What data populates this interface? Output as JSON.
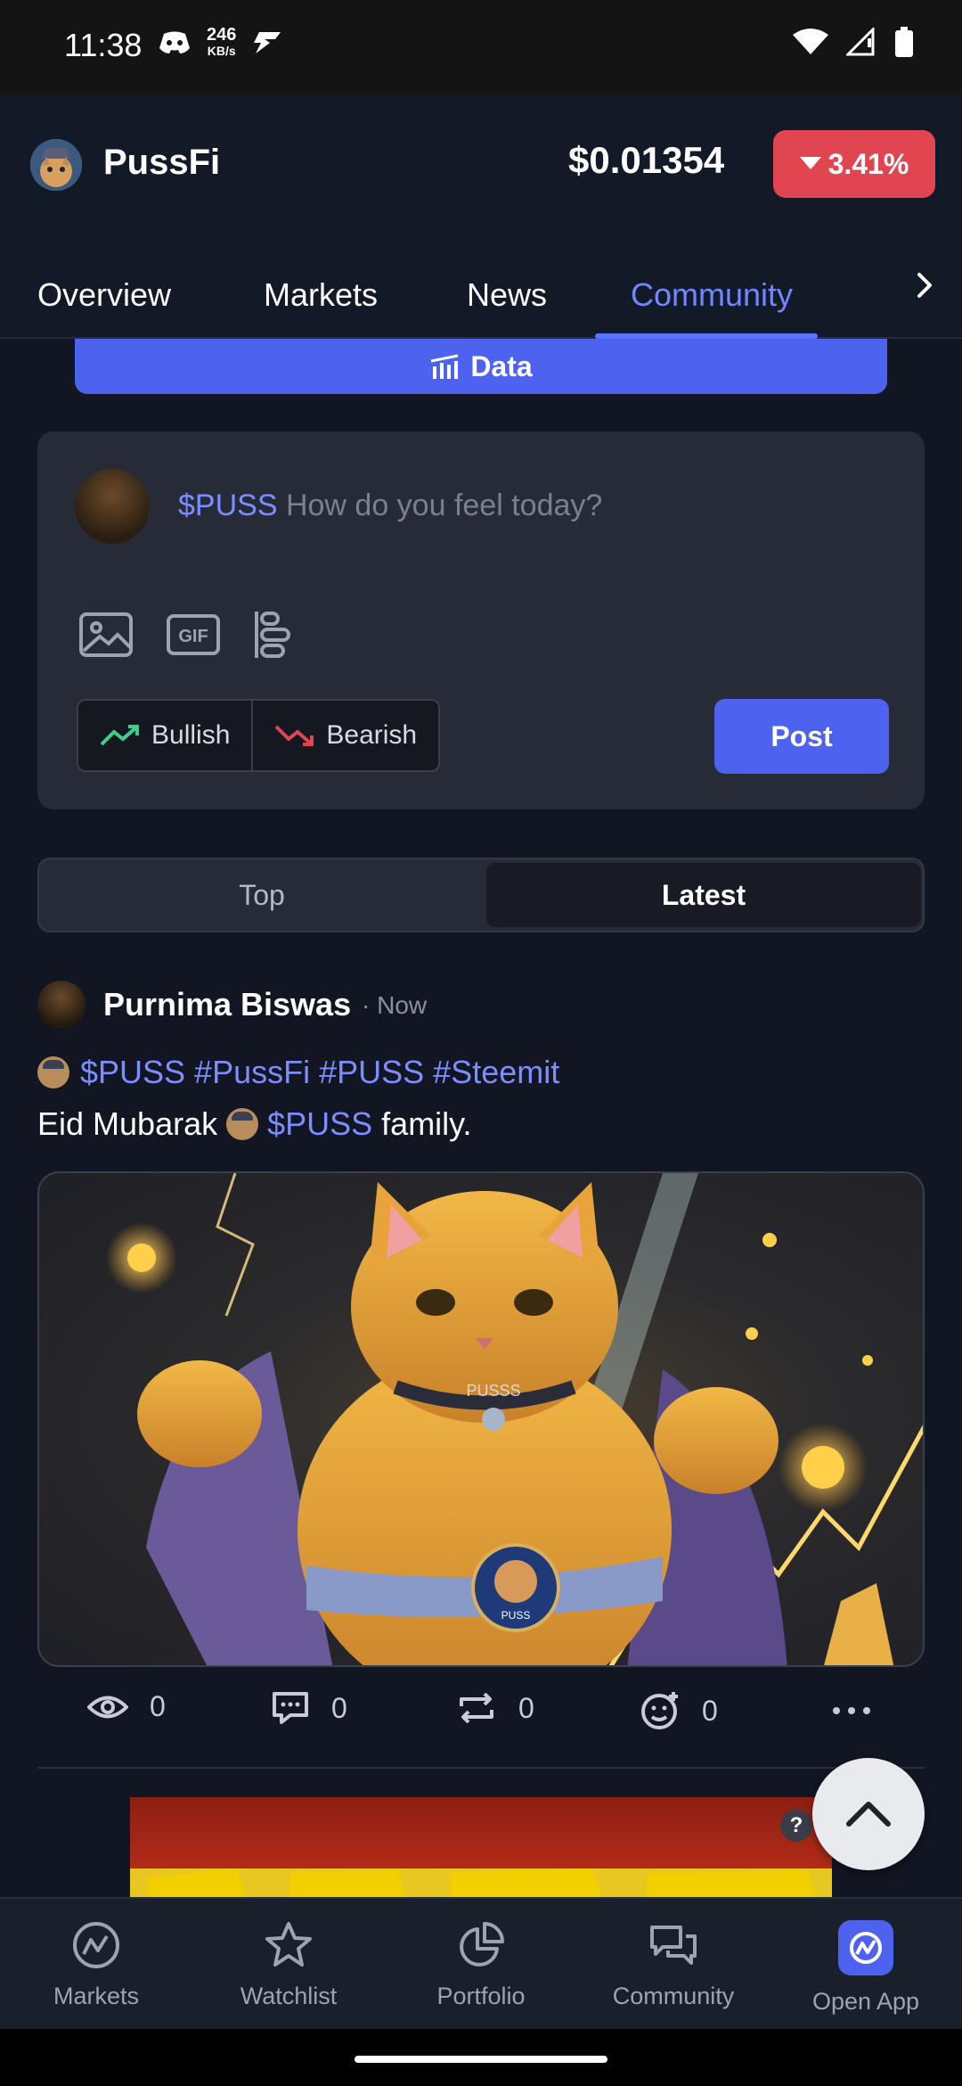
{
  "status_bar": {
    "time": "11:38",
    "net_speed": "246",
    "net_unit": "KB/s"
  },
  "header": {
    "app_name": "PussFi",
    "price": "$0.01354",
    "change": "3.41%"
  },
  "tabs": [
    {
      "label": "Overview"
    },
    {
      "label": "Markets"
    },
    {
      "label": "News"
    },
    {
      "label": "Community"
    }
  ],
  "data_button": {
    "label": "Data"
  },
  "composer": {
    "ticker_tag": "$PUSS",
    "placeholder": "How do you feel today?",
    "bullish_label": "Bullish",
    "bearish_label": "Bearish",
    "post_label": "Post",
    "gif_label": "GIF"
  },
  "sort": {
    "top_label": "Top",
    "latest_label": "Latest"
  },
  "post": {
    "author": "Purnima Biswas",
    "time": "· Now",
    "tags_line": "$PUSS #PussFi #PUSS #Steemit",
    "text_prefix": "Eid Mubarak",
    "text_tag": "$PUSS",
    "text_suffix": "family.",
    "image_collar_text": "PUSSS",
    "image_badge_text": "PUSS",
    "stats": {
      "views": "0",
      "comments": "0",
      "reposts": "0",
      "reactions": "0"
    }
  },
  "bottom_nav": [
    {
      "label": "Markets"
    },
    {
      "label": "Watchlist"
    },
    {
      "label": "Portfolio"
    },
    {
      "label": "Community"
    },
    {
      "label": "Open App"
    }
  ],
  "colors": {
    "accent": "#4d63f0",
    "negative": "#e04550",
    "bullish": "#3ecf8e",
    "bearish": "#e04550"
  }
}
